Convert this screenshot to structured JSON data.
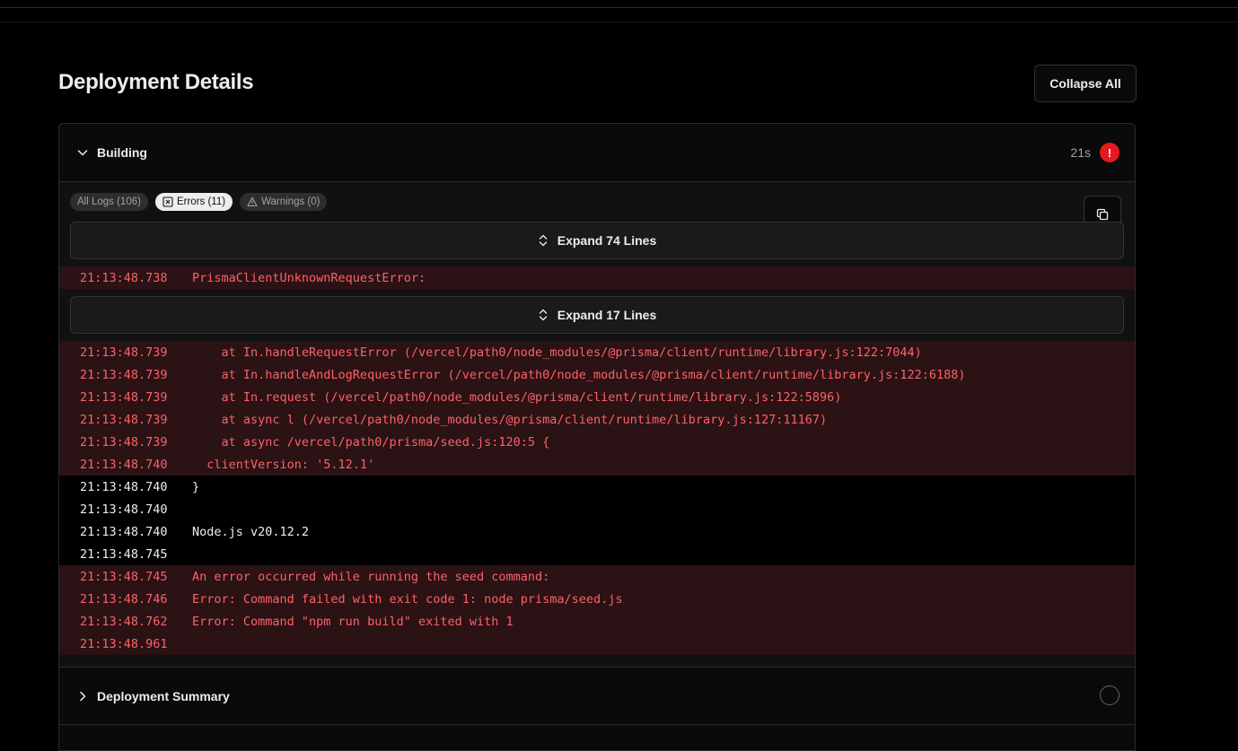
{
  "page": {
    "title": "Deployment Details",
    "collapse_label": "Collapse All"
  },
  "building": {
    "label": "Building",
    "duration": "21s",
    "error_mark": "!",
    "filters": {
      "all": "All Logs (106)",
      "errors": "Errors (11)",
      "warnings": "Warnings (0)",
      "active": "errors"
    },
    "expand_top": "Expand 74 Lines",
    "expand_mid": "Expand 17 Lines",
    "logs": [
      {
        "ts": "21:13:48.738",
        "msg": "PrismaClientUnknownRequestError:",
        "level": "error"
      },
      {
        "ts": "21:13:48.739",
        "msg": "    at In.handleRequestError (/vercel/path0/node_modules/@prisma/client/runtime/library.js:122:7044)",
        "level": "error"
      },
      {
        "ts": "21:13:48.739",
        "msg": "    at In.handleAndLogRequestError (/vercel/path0/node_modules/@prisma/client/runtime/library.js:122:6188)",
        "level": "error"
      },
      {
        "ts": "21:13:48.739",
        "msg": "    at In.request (/vercel/path0/node_modules/@prisma/client/runtime/library.js:122:5896)",
        "level": "error"
      },
      {
        "ts": "21:13:48.739",
        "msg": "    at async l (/vercel/path0/node_modules/@prisma/client/runtime/library.js:127:11167)",
        "level": "error"
      },
      {
        "ts": "21:13:48.739",
        "msg": "    at async /vercel/path0/prisma/seed.js:120:5 {",
        "level": "error"
      },
      {
        "ts": "21:13:48.740",
        "msg": "  clientVersion: '5.12.1'",
        "level": "error"
      },
      {
        "ts": "21:13:48.740",
        "msg": "}",
        "level": "info"
      },
      {
        "ts": "21:13:48.740",
        "msg": "",
        "level": "info"
      },
      {
        "ts": "21:13:48.740",
        "msg": "Node.js v20.12.2",
        "level": "info"
      },
      {
        "ts": "21:13:48.745",
        "msg": "",
        "level": "info"
      },
      {
        "ts": "21:13:48.745",
        "msg": "An error occurred while running the seed command:",
        "level": "error"
      },
      {
        "ts": "21:13:48.746",
        "msg": "Error: Command failed with exit code 1: node prisma/seed.js",
        "level": "error"
      },
      {
        "ts": "21:13:48.762",
        "msg": "Error: Command \"npm run build\" exited with 1",
        "level": "error"
      },
      {
        "ts": "21:13:48.961",
        "msg": "",
        "level": "error"
      }
    ]
  },
  "summary": {
    "label": "Deployment Summary"
  },
  "colors": {
    "error_text": "#ff6166",
    "error_bg": "#2a1215",
    "error_badge": "#e5191f"
  },
  "icons": {
    "header_chevron": "chevron-down-icon",
    "summary_chevron": "chevron-right-icon",
    "copy": "copy-icon",
    "expand": "expand-vertical-icon",
    "errors_filter": "x-square-icon",
    "warnings_filter": "warning-triangle-icon"
  }
}
